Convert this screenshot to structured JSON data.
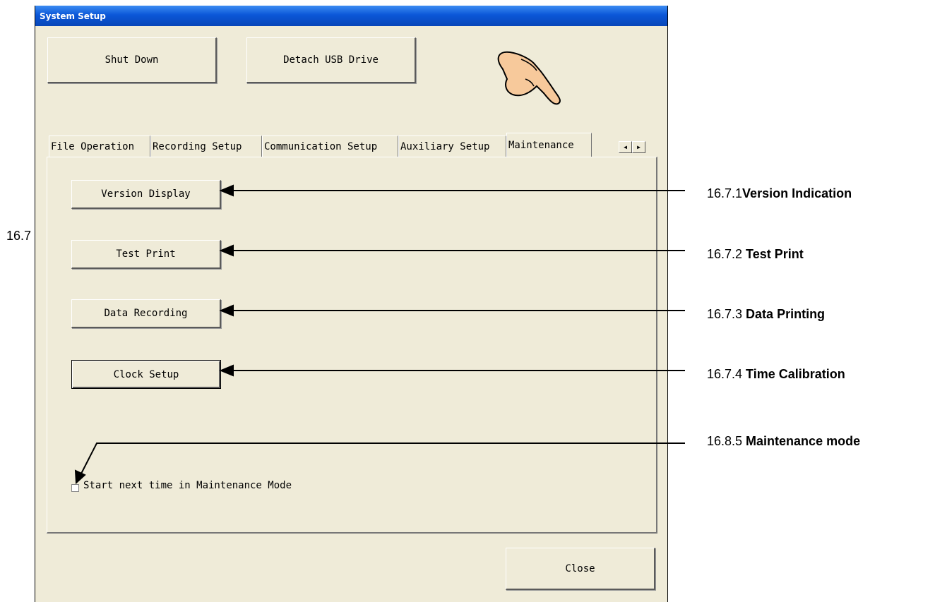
{
  "window": {
    "title": "System Setup"
  },
  "top_buttons": {
    "shut_down": "Shut Down",
    "detach_usb": "Detach USB Drive"
  },
  "tabs": [
    {
      "label": "File Operation"
    },
    {
      "label": "Recording Setup"
    },
    {
      "label": "Communication Setup"
    },
    {
      "label": "Auxiliary Setup"
    },
    {
      "label": "Maintenance"
    }
  ],
  "active_tab": "Maintenance",
  "maintenance": {
    "version_display": "Version Display",
    "test_print": "Test Print",
    "data_recording": "Data Recording",
    "clock_setup": "Clock Setup",
    "start_maintenance_checkbox": {
      "label": "Start next time in Maintenance Mode",
      "checked": false
    }
  },
  "close_button": "Close",
  "annotations": {
    "version": {
      "number": "16.7.1",
      "title": "Version Indication"
    },
    "test_print": {
      "number": "16.7.2 ",
      "title": "Test Print"
    },
    "data_printing": {
      "number": "16.7.3 ",
      "title": "Data Printing"
    },
    "time_calibration": {
      "number": "16.7.4 ",
      "title": "Time Calibration"
    },
    "maintenance_mode": {
      "number": "16.8.5 ",
      "title": "Maintenance mode"
    },
    "clipped_left": "16.7"
  },
  "icons": {
    "pointer": "pointing-hand-icon",
    "tab_left": "arrow-left-icon",
    "tab_right": "arrow-right-icon"
  }
}
